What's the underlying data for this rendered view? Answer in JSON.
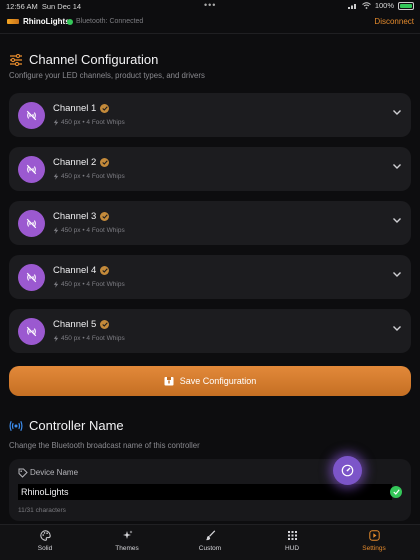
{
  "status": {
    "time": "12:56 AM",
    "date": "Sun Dec 14",
    "battery": "100%"
  },
  "app": {
    "brand": "RhinoLights",
    "connection": "Bluetooth: Connected",
    "disconnect": "Disconnect"
  },
  "channels_section": {
    "title": "Channel Configuration",
    "subtitle": "Configure your LED channels, product types, and drivers",
    "channels": [
      {
        "name": "Channel 1",
        "meta": "450 px  •  4 Foot Whips"
      },
      {
        "name": "Channel 2",
        "meta": "450 px  •  4 Foot Whips"
      },
      {
        "name": "Channel 3",
        "meta": "450 px  •  4 Foot Whips"
      },
      {
        "name": "Channel 4",
        "meta": "450 px  •  4 Foot Whips"
      },
      {
        "name": "Channel 5",
        "meta": "450 px  •  4 Foot Whips"
      }
    ],
    "save_label": "Save Configuration"
  },
  "controller": {
    "title": "Controller Name",
    "subtitle": "Change the Bluetooth broadcast name of this controller",
    "device_label": "Device Name",
    "device_value": "RhinoLights",
    "char_count": "11/31 characters"
  },
  "tabs": [
    {
      "label": "Solid",
      "icon": "palette-icon"
    },
    {
      "label": "Themes",
      "icon": "sparkles-icon"
    },
    {
      "label": "Custom",
      "icon": "brush-icon"
    },
    {
      "label": "HUD",
      "icon": "grid-icon"
    },
    {
      "label": "Settings",
      "icon": "settings-icon",
      "active": true
    }
  ],
  "colors": {
    "accent": "#e48a2c",
    "channel_avatar": "#9b59d0",
    "connected": "#34c759"
  }
}
